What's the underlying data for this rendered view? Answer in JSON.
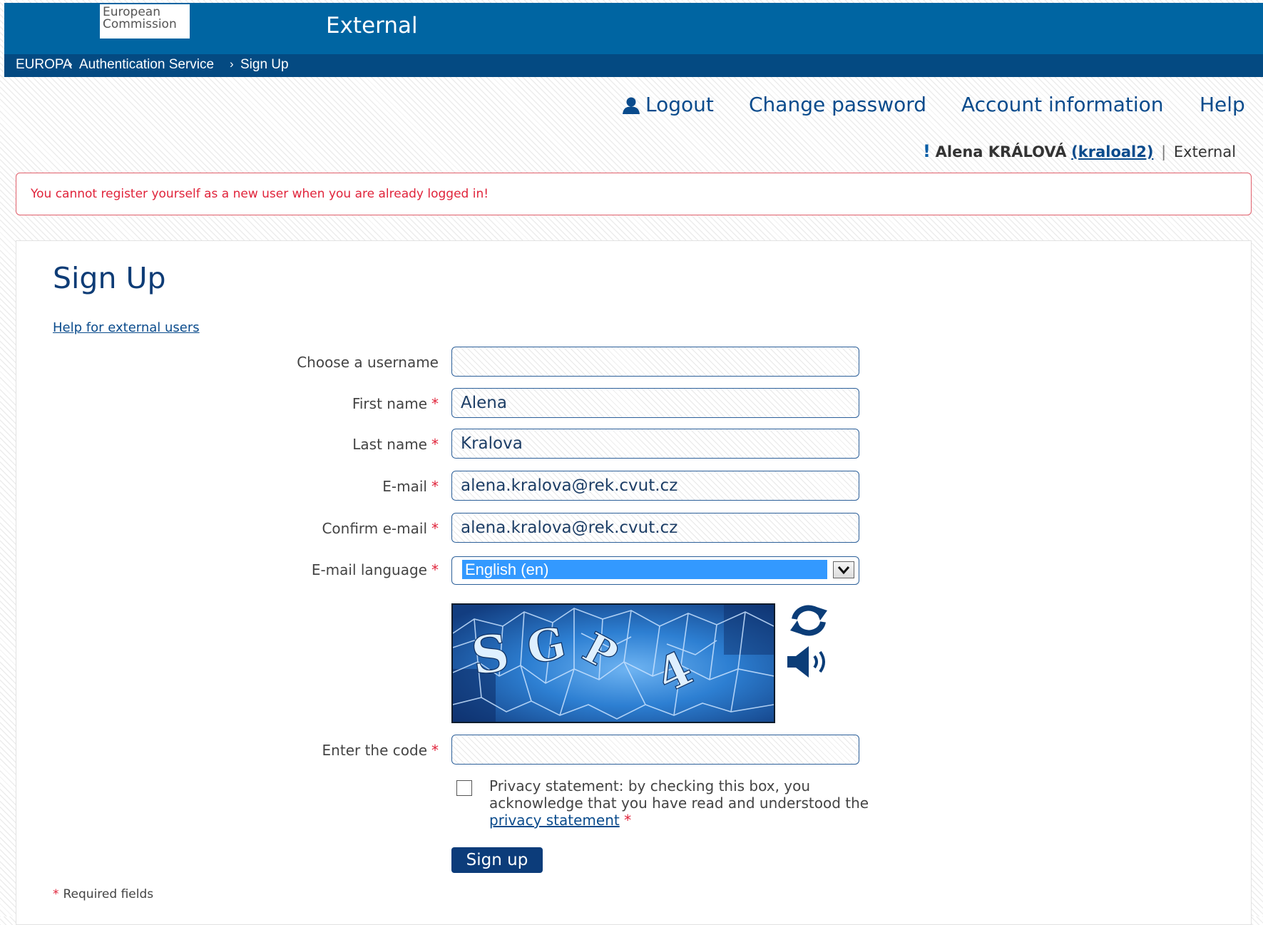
{
  "header": {
    "logo_line1": "European",
    "logo_line2": "Commission",
    "site_title": "External"
  },
  "breadcrumb": [
    "EUROPA",
    "Authentication Service",
    "Sign Up"
  ],
  "nav": {
    "logout": "Logout",
    "change_password": "Change password",
    "account_information": "Account information",
    "help": "Help"
  },
  "user": {
    "excl": "!",
    "name": "Alena KRÁLOVÁ",
    "login": "(kraloal2)",
    "separator": "|",
    "domain": "External"
  },
  "error": "You cannot register yourself as a new user when you are already logged in!",
  "page": {
    "title": "Sign Up",
    "help_link": "Help for external users"
  },
  "form": {
    "required_mark": "*",
    "username_label": "Choose a username",
    "username_value": "",
    "firstname_label": "First name",
    "firstname_value": "Alena",
    "lastname_label": "Last name",
    "lastname_value": "Kralova",
    "email_label": "E-mail",
    "email_value": "alena.kralova@rek.cvut.cz",
    "confirm_email_label": "Confirm e-mail",
    "confirm_email_value": "alena.kralova@rek.cvut.cz",
    "language_label": "E-mail language",
    "language_value": "English (en)",
    "captcha_text": "SGP4",
    "code_label": "Enter the code",
    "code_value": "",
    "privacy_text_before": "Privacy statement: by checking this box, you acknowledge that you have read and understood the ",
    "privacy_link": "privacy statement",
    "privacy_checked": false,
    "submit": "Sign up",
    "required_note": "Required fields"
  },
  "icons": {
    "logout": "user-icon",
    "refresh": "refresh-icon",
    "audio": "speaker-icon"
  },
  "colors": {
    "banner": "#0065a2",
    "breadcrumb_bar": "#044a82",
    "link": "#0a4b8c",
    "error": "#e0233a",
    "button": "#0c3c7a"
  }
}
